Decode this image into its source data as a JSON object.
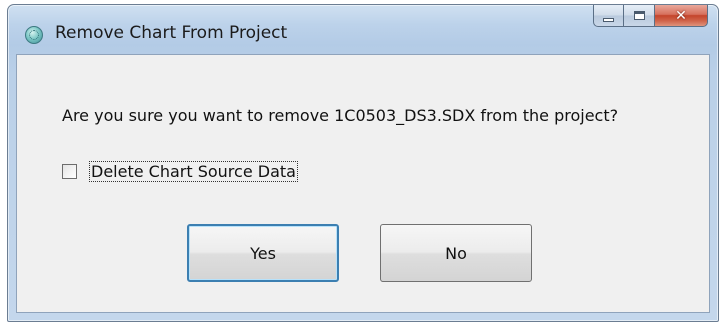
{
  "window": {
    "title": "Remove Chart From Project",
    "close_symbol": "✕"
  },
  "dialog": {
    "message": "Are you sure you want to remove 1C0503_DS3.SDX from the project?",
    "checkbox_label": "Delete Chart Source Data",
    "checkbox_checked": false,
    "yes_label": "Yes",
    "no_label": "No"
  },
  "icons": {
    "app": "chart-globe-icon",
    "minimize": "minimize-icon",
    "maximize": "maximize-icon",
    "close": "close-icon"
  }
}
